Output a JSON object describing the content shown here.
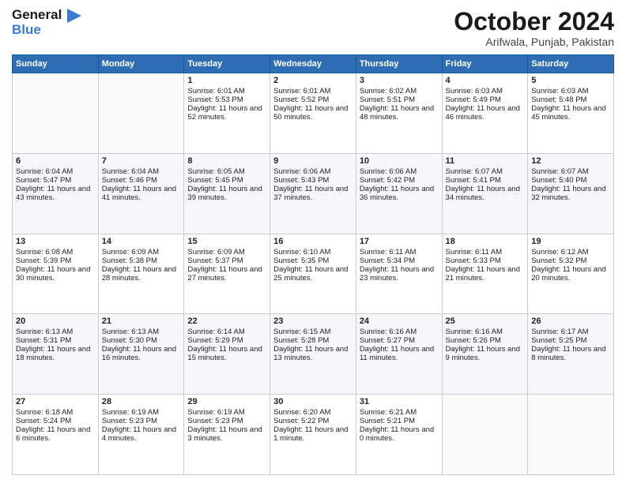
{
  "header": {
    "logo_line1": "General",
    "logo_line2": "Blue",
    "month": "October 2024",
    "location": "Arifwala, Punjab, Pakistan"
  },
  "weekdays": [
    "Sunday",
    "Monday",
    "Tuesday",
    "Wednesday",
    "Thursday",
    "Friday",
    "Saturday"
  ],
  "rows": [
    [
      {
        "day": "",
        "empty": true
      },
      {
        "day": "",
        "empty": true
      },
      {
        "day": "1",
        "sunrise": "Sunrise: 6:01 AM",
        "sunset": "Sunset: 5:53 PM",
        "daylight": "Daylight: 11 hours and 52 minutes."
      },
      {
        "day": "2",
        "sunrise": "Sunrise: 6:01 AM",
        "sunset": "Sunset: 5:52 PM",
        "daylight": "Daylight: 11 hours and 50 minutes."
      },
      {
        "day": "3",
        "sunrise": "Sunrise: 6:02 AM",
        "sunset": "Sunset: 5:51 PM",
        "daylight": "Daylight: 11 hours and 48 minutes."
      },
      {
        "day": "4",
        "sunrise": "Sunrise: 6:03 AM",
        "sunset": "Sunset: 5:49 PM",
        "daylight": "Daylight: 11 hours and 46 minutes."
      },
      {
        "day": "5",
        "sunrise": "Sunrise: 6:03 AM",
        "sunset": "Sunset: 5:48 PM",
        "daylight": "Daylight: 11 hours and 45 minutes."
      }
    ],
    [
      {
        "day": "6",
        "sunrise": "Sunrise: 6:04 AM",
        "sunset": "Sunset: 5:47 PM",
        "daylight": "Daylight: 11 hours and 43 minutes."
      },
      {
        "day": "7",
        "sunrise": "Sunrise: 6:04 AM",
        "sunset": "Sunset: 5:46 PM",
        "daylight": "Daylight: 11 hours and 41 minutes."
      },
      {
        "day": "8",
        "sunrise": "Sunrise: 6:05 AM",
        "sunset": "Sunset: 5:45 PM",
        "daylight": "Daylight: 11 hours and 39 minutes."
      },
      {
        "day": "9",
        "sunrise": "Sunrise: 6:06 AM",
        "sunset": "Sunset: 5:43 PM",
        "daylight": "Daylight: 11 hours and 37 minutes."
      },
      {
        "day": "10",
        "sunrise": "Sunrise: 6:06 AM",
        "sunset": "Sunset: 5:42 PM",
        "daylight": "Daylight: 11 hours and 36 minutes."
      },
      {
        "day": "11",
        "sunrise": "Sunrise: 6:07 AM",
        "sunset": "Sunset: 5:41 PM",
        "daylight": "Daylight: 11 hours and 34 minutes."
      },
      {
        "day": "12",
        "sunrise": "Sunrise: 6:07 AM",
        "sunset": "Sunset: 5:40 PM",
        "daylight": "Daylight: 11 hours and 32 minutes."
      }
    ],
    [
      {
        "day": "13",
        "sunrise": "Sunrise: 6:08 AM",
        "sunset": "Sunset: 5:39 PM",
        "daylight": "Daylight: 11 hours and 30 minutes."
      },
      {
        "day": "14",
        "sunrise": "Sunrise: 6:09 AM",
        "sunset": "Sunset: 5:38 PM",
        "daylight": "Daylight: 11 hours and 28 minutes."
      },
      {
        "day": "15",
        "sunrise": "Sunrise: 6:09 AM",
        "sunset": "Sunset: 5:37 PM",
        "daylight": "Daylight: 11 hours and 27 minutes."
      },
      {
        "day": "16",
        "sunrise": "Sunrise: 6:10 AM",
        "sunset": "Sunset: 5:35 PM",
        "daylight": "Daylight: 11 hours and 25 minutes."
      },
      {
        "day": "17",
        "sunrise": "Sunrise: 6:11 AM",
        "sunset": "Sunset: 5:34 PM",
        "daylight": "Daylight: 11 hours and 23 minutes."
      },
      {
        "day": "18",
        "sunrise": "Sunrise: 6:11 AM",
        "sunset": "Sunset: 5:33 PM",
        "daylight": "Daylight: 11 hours and 21 minutes."
      },
      {
        "day": "19",
        "sunrise": "Sunrise: 6:12 AM",
        "sunset": "Sunset: 5:32 PM",
        "daylight": "Daylight: 11 hours and 20 minutes."
      }
    ],
    [
      {
        "day": "20",
        "sunrise": "Sunrise: 6:13 AM",
        "sunset": "Sunset: 5:31 PM",
        "daylight": "Daylight: 11 hours and 18 minutes."
      },
      {
        "day": "21",
        "sunrise": "Sunrise: 6:13 AM",
        "sunset": "Sunset: 5:30 PM",
        "daylight": "Daylight: 11 hours and 16 minutes."
      },
      {
        "day": "22",
        "sunrise": "Sunrise: 6:14 AM",
        "sunset": "Sunset: 5:29 PM",
        "daylight": "Daylight: 11 hours and 15 minutes."
      },
      {
        "day": "23",
        "sunrise": "Sunrise: 6:15 AM",
        "sunset": "Sunset: 5:28 PM",
        "daylight": "Daylight: 11 hours and 13 minutes."
      },
      {
        "day": "24",
        "sunrise": "Sunrise: 6:16 AM",
        "sunset": "Sunset: 5:27 PM",
        "daylight": "Daylight: 11 hours and 11 minutes."
      },
      {
        "day": "25",
        "sunrise": "Sunrise: 6:16 AM",
        "sunset": "Sunset: 5:26 PM",
        "daylight": "Daylight: 11 hours and 9 minutes."
      },
      {
        "day": "26",
        "sunrise": "Sunrise: 6:17 AM",
        "sunset": "Sunset: 5:25 PM",
        "daylight": "Daylight: 11 hours and 8 minutes."
      }
    ],
    [
      {
        "day": "27",
        "sunrise": "Sunrise: 6:18 AM",
        "sunset": "Sunset: 5:24 PM",
        "daylight": "Daylight: 11 hours and 6 minutes."
      },
      {
        "day": "28",
        "sunrise": "Sunrise: 6:19 AM",
        "sunset": "Sunset: 5:23 PM",
        "daylight": "Daylight: 11 hours and 4 minutes."
      },
      {
        "day": "29",
        "sunrise": "Sunrise: 6:19 AM",
        "sunset": "Sunset: 5:23 PM",
        "daylight": "Daylight: 11 hours and 3 minutes."
      },
      {
        "day": "30",
        "sunrise": "Sunrise: 6:20 AM",
        "sunset": "Sunset: 5:22 PM",
        "daylight": "Daylight: 11 hours and 1 minute."
      },
      {
        "day": "31",
        "sunrise": "Sunrise: 6:21 AM",
        "sunset": "Sunset: 5:21 PM",
        "daylight": "Daylight: 11 hours and 0 minutes."
      },
      {
        "day": "",
        "empty": true
      },
      {
        "day": "",
        "empty": true
      }
    ]
  ]
}
